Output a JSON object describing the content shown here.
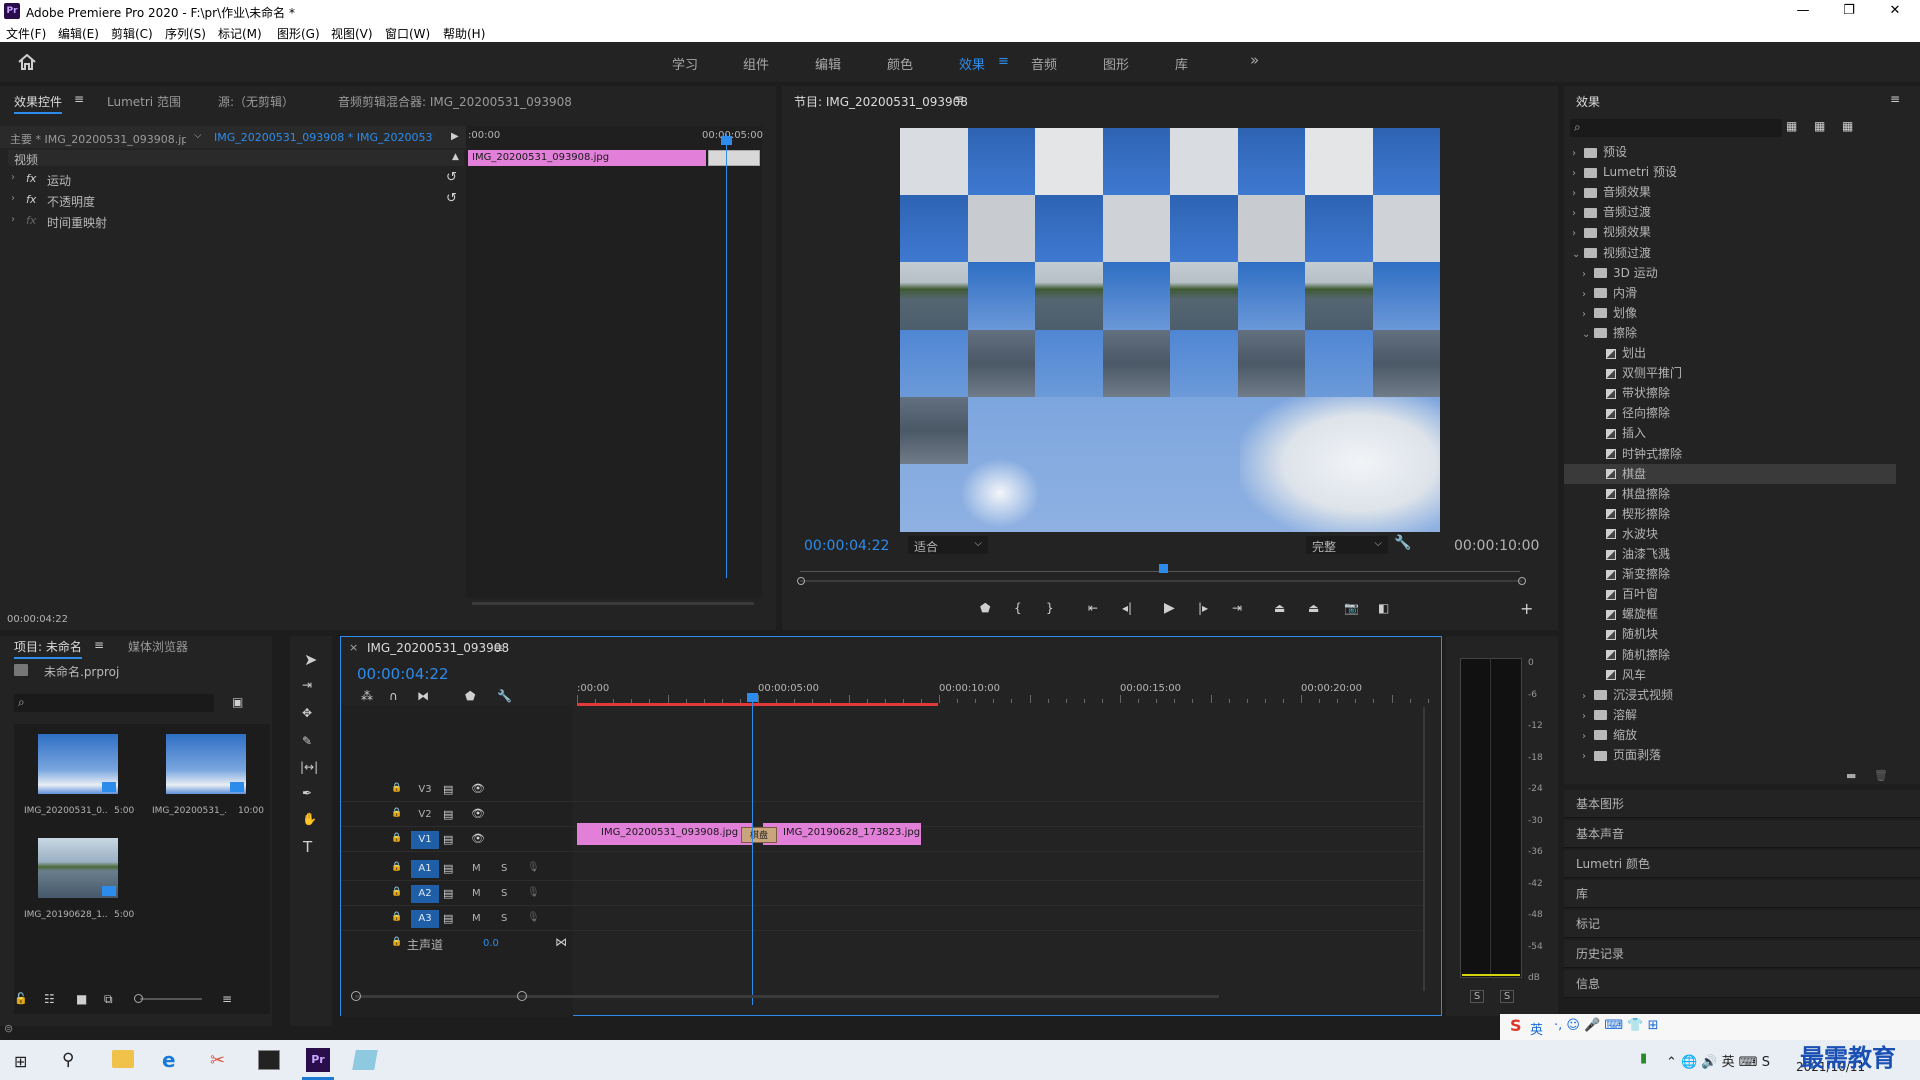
{
  "window": {
    "title": "Adobe Premiere Pro 2020 - F:\\pr\\作业\\未命名 *",
    "app_icon": "Pr",
    "minimize": "—",
    "maximize": "❐",
    "close": "✕"
  },
  "menu": [
    "文件(F)",
    "编辑(E)",
    "剪辑(C)",
    "序列(S)",
    "标记(M)",
    "图形(G)",
    "视图(V)",
    "窗口(W)",
    "帮助(H)"
  ],
  "workspaces": {
    "items": [
      "学习",
      "组件",
      "编辑",
      "颜色",
      "效果",
      "音频",
      "图形",
      "库"
    ],
    "active": "效果",
    "more": "»"
  },
  "effect_controls": {
    "tabs": [
      "效果控件",
      "Lumetri 范围",
      "源:（无剪辑）",
      "音频剪辑混合器: IMG_20200531_093908"
    ],
    "master": "主要 * IMG_20200531_093908.jpg",
    "sequence": "IMG_20200531_093908 * IMG_20200531_...",
    "section": "视频",
    "rows": [
      "运动",
      "不透明度",
      "时间重映射"
    ],
    "fx": "fx",
    "ruler_start": ":00:00",
    "ruler_end": "00:00:05:00",
    "clip": "IMG_20200531_093908.jpg",
    "timecode": "00:00:04:22"
  },
  "program": {
    "title": "节目: IMG_20200531_093908",
    "timecode": "00:00:04:22",
    "fit": "适合",
    "quality": "完整",
    "duration": "00:00:10:00"
  },
  "effects": {
    "title": "效果",
    "search_placeholder": "",
    "top": [
      "预设",
      "Lumetri 预设",
      "音频效果",
      "音频过渡",
      "视频效果",
      "视频过渡"
    ],
    "sub": [
      "3D 运动",
      "内滑",
      "划像",
      "擦除"
    ],
    "wipes": [
      "划出",
      "双侧平推门",
      "带状擦除",
      "径向擦除",
      "插入",
      "时钟式擦除",
      "棋盘",
      "棋盘擦除",
      "楔形擦除",
      "水波块",
      "油漆飞溅",
      "渐变擦除",
      "百叶窗",
      "螺旋框",
      "随机块",
      "随机擦除",
      "风车"
    ],
    "selected": "棋盘",
    "rest": [
      "沉浸式视频",
      "溶解",
      "缩放",
      "页面剥落"
    ],
    "bottom": [
      "基本图形",
      "基本声音",
      "Lumetri 颜色",
      "库",
      "标记",
      "历史记录",
      "信息"
    ]
  },
  "project": {
    "tabs": [
      "项目: 未命名",
      "媒体浏览器"
    ],
    "file": "未命名.prproj",
    "items": [
      {
        "name": "IMG_20200531_0...",
        "dur": "5:00"
      },
      {
        "name": "IMG_20200531_...",
        "dur": "10:00"
      },
      {
        "name": "IMG_20190628_1...",
        "dur": "5:00"
      }
    ]
  },
  "timeline": {
    "tab": "IMG_20200531_093908",
    "timecode": "00:00:04:22",
    "ruler": [
      ":00:00",
      "00:00:05:00",
      "00:00:10:00",
      "00:00:15:00",
      "00:00:20:00"
    ],
    "video_tracks": [
      "V3",
      "V2",
      "V1"
    ],
    "audio_tracks": [
      "A1",
      "A2",
      "A3"
    ],
    "master": "主声道",
    "master_val": "0.0",
    "M": "M",
    "S": "S",
    "clip1": "IMG_20200531_093908.jpg",
    "transition": "棋盘",
    "clip2": "IMG_20190628_173823.jpg"
  },
  "meter": {
    "scale": [
      "0",
      "-6",
      "-12",
      "-18",
      "-24",
      "-30",
      "-36",
      "-42",
      "-48",
      "-54",
      "dB"
    ],
    "solo": [
      "S",
      "S"
    ]
  },
  "taskbar": {
    "date": "2021/10/11",
    "watermark": "最需教育",
    "ime": "英"
  },
  "colors": {
    "accent": "#2d8ceb",
    "clip": "#e17fd9",
    "panel": "#232323"
  }
}
